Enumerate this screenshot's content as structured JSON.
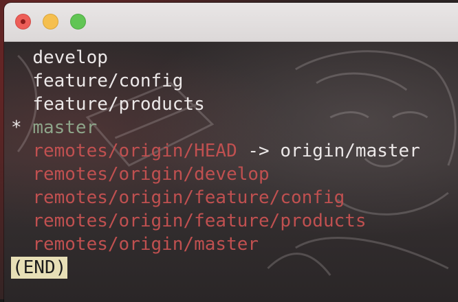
{
  "window": {
    "controls": {
      "close": "close-button",
      "minimize": "minimize-button",
      "maximize": "maximize-button"
    }
  },
  "terminal": {
    "colors": {
      "plain": "#ece8e8",
      "current_branch": "#8ea58a",
      "remote_branch": "#c05050",
      "pager_end_bg": "#e7dfb6"
    },
    "branches": [
      {
        "prefix": "  ",
        "name": "develop"
      },
      {
        "prefix": "  ",
        "name": "feature/config"
      },
      {
        "prefix": "  ",
        "name": "feature/products"
      },
      {
        "prefix": "* ",
        "name": "master"
      },
      {
        "prefix": "  ",
        "name": "remotes/origin/HEAD",
        "arrow": " -> origin/master"
      },
      {
        "prefix": "  ",
        "name": "remotes/origin/develop"
      },
      {
        "prefix": "  ",
        "name": "remotes/origin/feature/config"
      },
      {
        "prefix": "  ",
        "name": "remotes/origin/feature/products"
      },
      {
        "prefix": "  ",
        "name": "remotes/origin/master"
      }
    ],
    "pager_status": "(END)"
  }
}
